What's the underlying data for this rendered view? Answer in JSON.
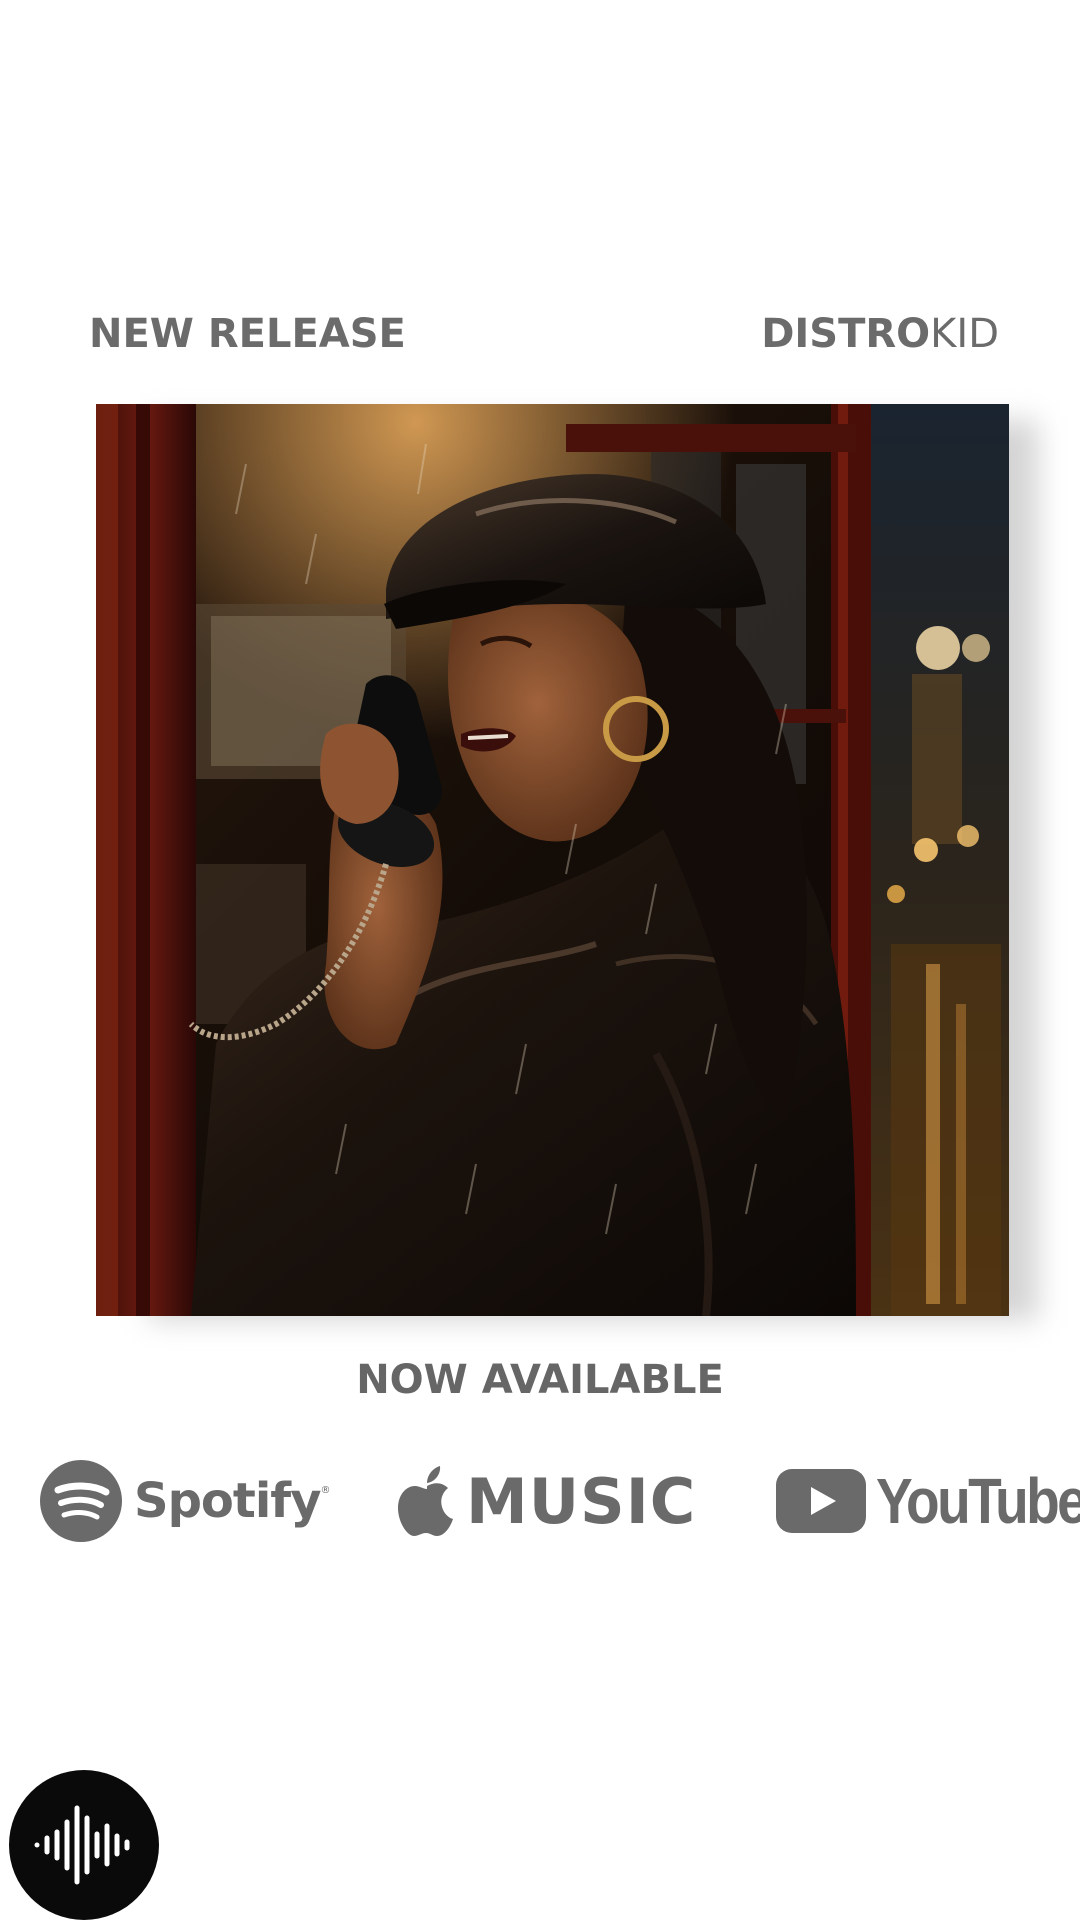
{
  "header": {
    "tagline": "NEW RELEASE",
    "brand_bold": "DISTRO",
    "brand_light": "KID"
  },
  "cover": {
    "icon": "album-cover-art"
  },
  "availability": {
    "label": "NOW AVAILABLE"
  },
  "platforms": {
    "spotify": {
      "label": "Spotify",
      "mark": "®",
      "icon": "spotify-icon"
    },
    "apple": {
      "label": "MUSIC",
      "icon": "apple-icon"
    },
    "youtube": {
      "label": "YouTube",
      "icon": "youtube-play-icon"
    }
  },
  "badge": {
    "icon": "soundwave-icon"
  },
  "colors": {
    "text_gray": "#6b6b6b",
    "background": "#ffffff",
    "badge": "#0a0a0a"
  }
}
